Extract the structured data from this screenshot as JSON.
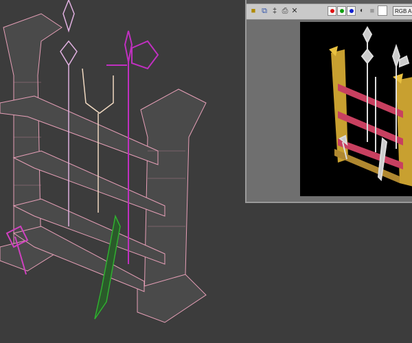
{
  "viewport": {
    "background": "#3c3c3c",
    "wire_color": "#e8a0b8",
    "polearm_color": "#c030c0",
    "sword_color": "#30b030"
  },
  "render_window": {
    "toolbar": {
      "icons": [
        "save-icon",
        "clone-icon",
        "copy-icon",
        "print-icon",
        "clear-icon"
      ],
      "channels": [
        {
          "name": "red-channel",
          "color": "#e01010"
        },
        {
          "name": "green-channel",
          "color": "#10a010"
        },
        {
          "name": "blue-channel",
          "color": "#1020d0"
        }
      ],
      "channel_select": "RGB Alph"
    }
  }
}
